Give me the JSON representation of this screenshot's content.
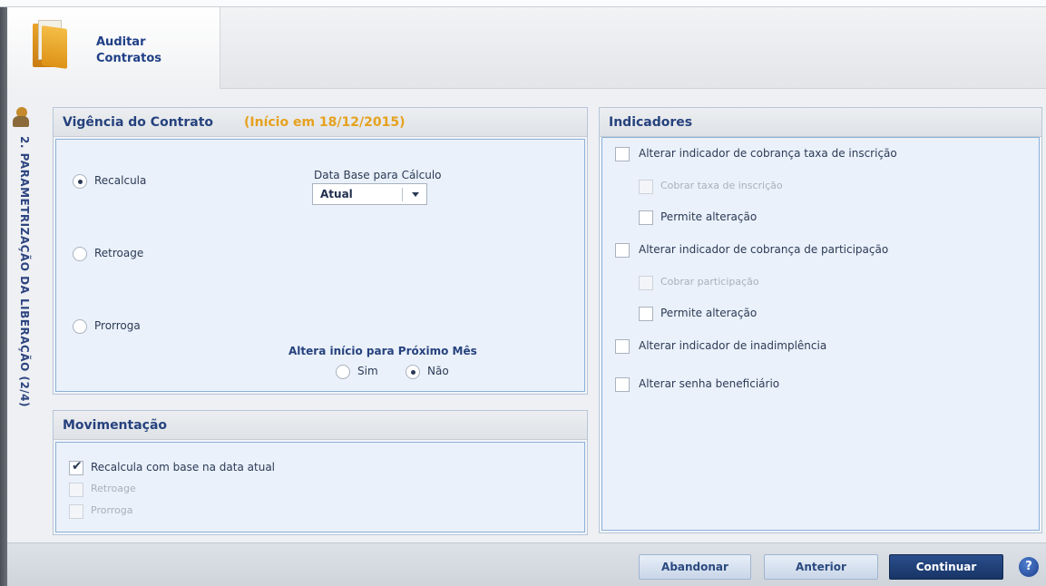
{
  "header": {
    "title": "Auditar Contratos"
  },
  "side": {
    "label": "2. PARAMETRIZAÇÃO DA LIBERAÇÃO (2/4)"
  },
  "vigencia": {
    "title": "Vigência do Contrato",
    "subtitle": "(Início em 18/12/2015)",
    "options": [
      "Recalcula",
      "Retroage",
      "Prorroga"
    ],
    "selected": "Recalcula",
    "data_base_label": "Data Base para Cálculo",
    "data_base_value": "Atual",
    "proximo_mes_label": "Altera início para Próximo Mês",
    "sim_label": "Sim",
    "nao_label": "Não",
    "proximo_mes_selected": "Não"
  },
  "movimentacao": {
    "title": "Movimentação",
    "items": [
      {
        "label": "Recalcula com base na data atual",
        "checked": true,
        "enabled": true
      },
      {
        "label": "Retroage",
        "checked": false,
        "enabled": false
      },
      {
        "label": "Prorroga",
        "checked": false,
        "enabled": false
      }
    ]
  },
  "indicadores": {
    "title": "Indicadores",
    "items": [
      {
        "label": "Alterar indicador de cobrança taxa de inscrição",
        "checked": false,
        "enabled": true
      },
      {
        "label": "Cobrar taxa de inscrição",
        "checked": false,
        "enabled": false
      },
      {
        "label": "Permite alteração",
        "checked": false,
        "enabled": true
      },
      {
        "label": "Alterar indicador de cobrança de participação",
        "checked": false,
        "enabled": true
      },
      {
        "label": "Cobrar participação",
        "checked": false,
        "enabled": false
      },
      {
        "label": "Permite alteração",
        "checked": false,
        "enabled": true
      },
      {
        "label": "Alterar indicador de inadimplência",
        "checked": false,
        "enabled": true
      },
      {
        "label": "Alterar senha beneficiário",
        "checked": false,
        "enabled": true
      }
    ]
  },
  "footer": {
    "abandonar": "Abandonar",
    "anterior": "Anterior",
    "continuar": "Continuar",
    "help": "?"
  },
  "colors": {
    "accent": "#26427e",
    "subtitle": "#e6a11d",
    "primary_button": "#1f3f76"
  }
}
